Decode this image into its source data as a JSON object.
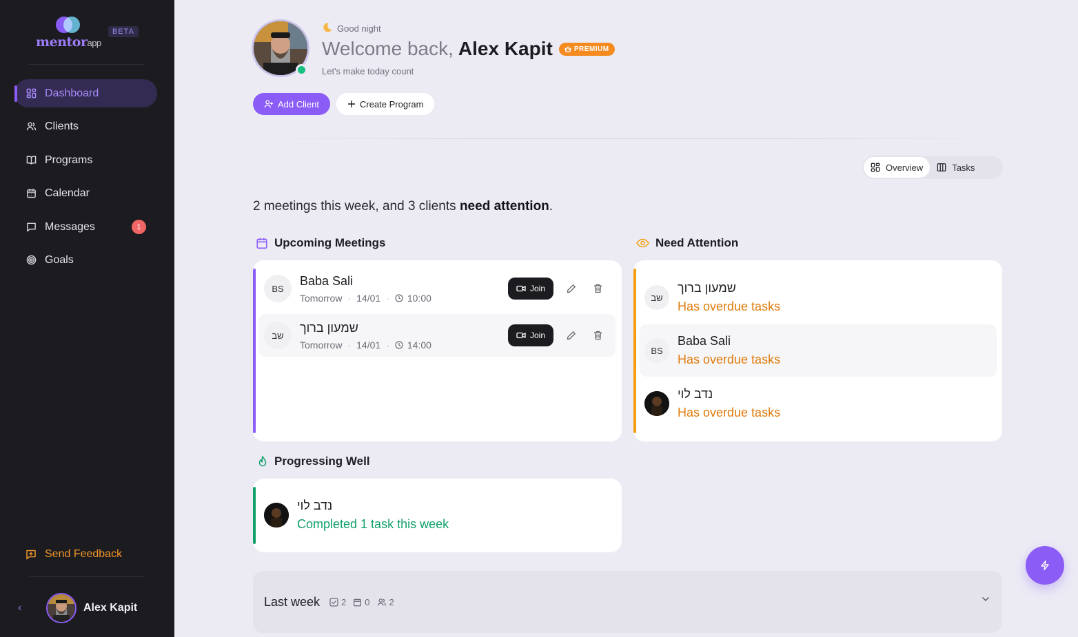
{
  "brand": {
    "logo_main": "mentor",
    "logo_suffix": "app",
    "beta_label": "BETA"
  },
  "sidebar": {
    "items": [
      {
        "label": "Dashboard",
        "icon": "dashboard-grid-icon",
        "active": true
      },
      {
        "label": "Clients",
        "icon": "users-icon"
      },
      {
        "label": "Programs",
        "icon": "book-icon"
      },
      {
        "label": "Calendar",
        "icon": "calendar-icon"
      },
      {
        "label": "Messages",
        "icon": "message-icon",
        "badge": "1"
      },
      {
        "label": "Goals",
        "icon": "target-icon"
      }
    ],
    "feedback_label": "Send Feedback",
    "user_name": "Alex Kapit"
  },
  "header": {
    "greeting": "Good night",
    "welcome_prefix": "Welcome back,",
    "user_name": "Alex Kapit",
    "premium_label": "PREMIUM",
    "subtext": "Let's make today count",
    "add_client_label": "Add Client",
    "create_program_label": "Create Program"
  },
  "view_toggle": {
    "overview_label": "Overview",
    "tasks_label": "Tasks",
    "active": "overview"
  },
  "summary": {
    "text": "2 meetings this week, and 3 clients",
    "bold": "need attention",
    "end": "."
  },
  "upcoming": {
    "title": "Upcoming Meetings",
    "join_label": "Join",
    "meetings": [
      {
        "initials": "BS",
        "name": "Baba Sali",
        "day": "Tomorrow",
        "date": "14/01",
        "time": "10:00"
      },
      {
        "initials": "שב",
        "name": "שמעון ברוך",
        "day": "Tomorrow",
        "date": "14/01",
        "time": "14:00"
      }
    ]
  },
  "attention": {
    "title": "Need Attention",
    "clients": [
      {
        "initials": "שב",
        "name": "שמעון ברוך",
        "status": "Has overdue tasks"
      },
      {
        "initials": "BS",
        "name": "Baba Sali",
        "status": "Has overdue tasks"
      },
      {
        "initials": "",
        "name": "נדב לוי",
        "status": "Has overdue tasks"
      }
    ]
  },
  "progressing": {
    "title": "Progressing Well",
    "clients": [
      {
        "name": "נדב לוי",
        "status": "Completed 1 task this week"
      }
    ]
  },
  "last_week": {
    "title": "Last week",
    "tasks": "2",
    "meetings": "0",
    "clients": "2"
  },
  "colors": {
    "accent": "#8b5cf6",
    "attention": "#f59e0b",
    "success": "#10a068",
    "sidebar_bg": "#1c1c20"
  }
}
